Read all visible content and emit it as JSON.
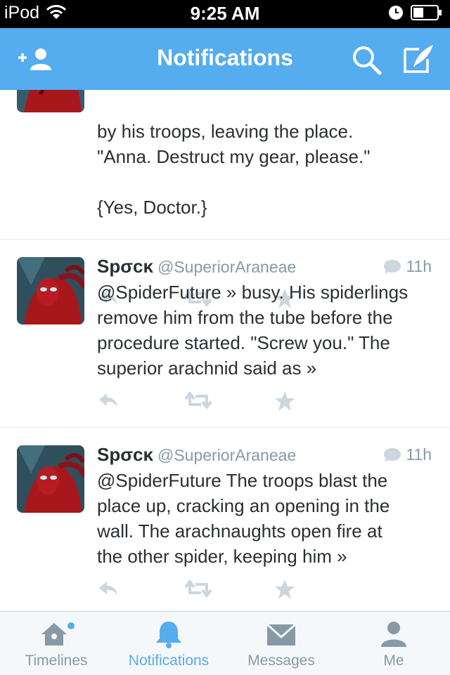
{
  "status_bar": {
    "carrier": "iPod",
    "time": "9:25 AM"
  },
  "nav": {
    "title": "Notifications",
    "add_user_icon": "add-user-icon",
    "search_icon": "search-icon",
    "compose_icon": "compose-icon"
  },
  "tweets": [
    {
      "author_name": "",
      "author_handle": "",
      "time": "",
      "lines": [
        "by his troops, leaving the place.",
        "\"Anna. Destruct my gear, please.\"",
        "",
        "{Yes, Doctor.}"
      ]
    },
    {
      "author_name": "Spσcκ",
      "author_handle": "@SuperiorAraneae",
      "time": "11h",
      "lines": [
        "@SpiderFuture » busy. His spiderlings",
        "remove him from the tube before the",
        "procedure started. \"Screw you.\" The",
        "superior arachnid said as »"
      ]
    },
    {
      "author_name": "Spσcκ",
      "author_handle": "@SuperiorAraneae",
      "time": "11h",
      "lines": [
        "@SpiderFuture The troops blast the",
        "place up, cracking an opening in the",
        "wall. The arachnaughts open fire at",
        "the other spider, keeping him »"
      ]
    }
  ],
  "tabs": [
    {
      "label": "Timelines",
      "icon": "home-icon",
      "active": false
    },
    {
      "label": "Notifications",
      "icon": "bell-icon",
      "active": true
    },
    {
      "label": "Messages",
      "icon": "envelope-icon",
      "active": false
    },
    {
      "label": "Me",
      "icon": "person-icon",
      "active": false
    }
  ],
  "colors": {
    "accent": "#55acee",
    "text": "#292f33",
    "muted": "#8899a6",
    "action": "#ccd6dd"
  }
}
